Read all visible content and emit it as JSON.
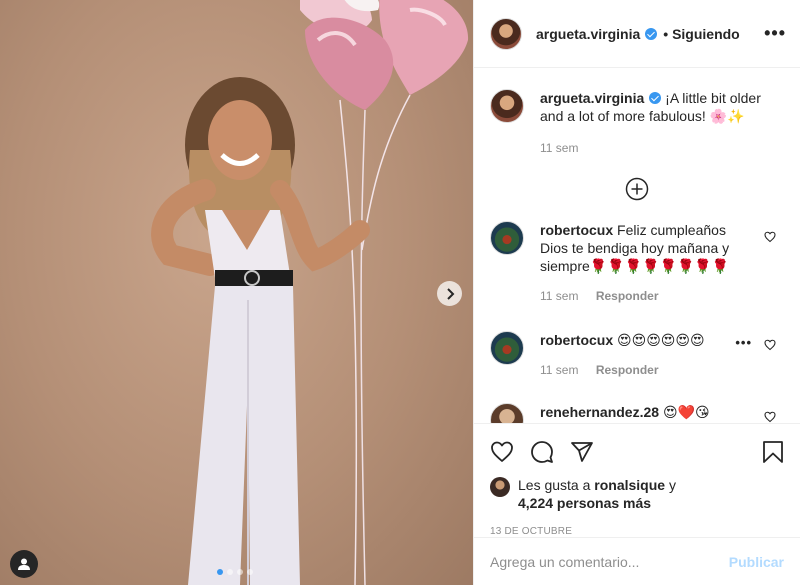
{
  "post": {
    "username": "argueta.virginia",
    "follow_status": "Siguiendo",
    "more_label": "•••",
    "caption_text": "¡A little bit older and a lot of more fabulous! 🌸✨",
    "caption_time": "11 sem"
  },
  "comments": [
    {
      "username": "robertocux",
      "text": "Feliz cumpleaños Dios te bendiga hoy mañana y siempre🌹🌹🌹🌹🌹🌹🌹🌹",
      "time": "11 sem",
      "reply": "Responder"
    },
    {
      "username": "robertocux",
      "text": "😍😍😍😍😍😍",
      "time": "11 sem",
      "reply": "Responder",
      "options": "•••"
    },
    {
      "username": "renehernandez.28",
      "text": "😍❤️😘"
    }
  ],
  "likes": {
    "prefix": "Les gusta a",
    "liker": "ronalsique",
    "connector": "y",
    "others": "4,224 personas más"
  },
  "date": "13 DE OCTUBRE",
  "comment_box": {
    "placeholder": "Agrega un comentario...",
    "post_label": "Publicar"
  },
  "carousel": {
    "total": 4,
    "active": 1
  },
  "colors": {
    "accent": "#3897f0",
    "publish_disabled": "#b3dbff",
    "photo_bg": "#b48f76"
  },
  "icons": [
    "verified-badge-icon",
    "more-options-icon",
    "load-more-icon",
    "heart-icon",
    "comment-icon",
    "share-icon",
    "save-icon",
    "next-arrow-icon",
    "user-tag-icon"
  ]
}
